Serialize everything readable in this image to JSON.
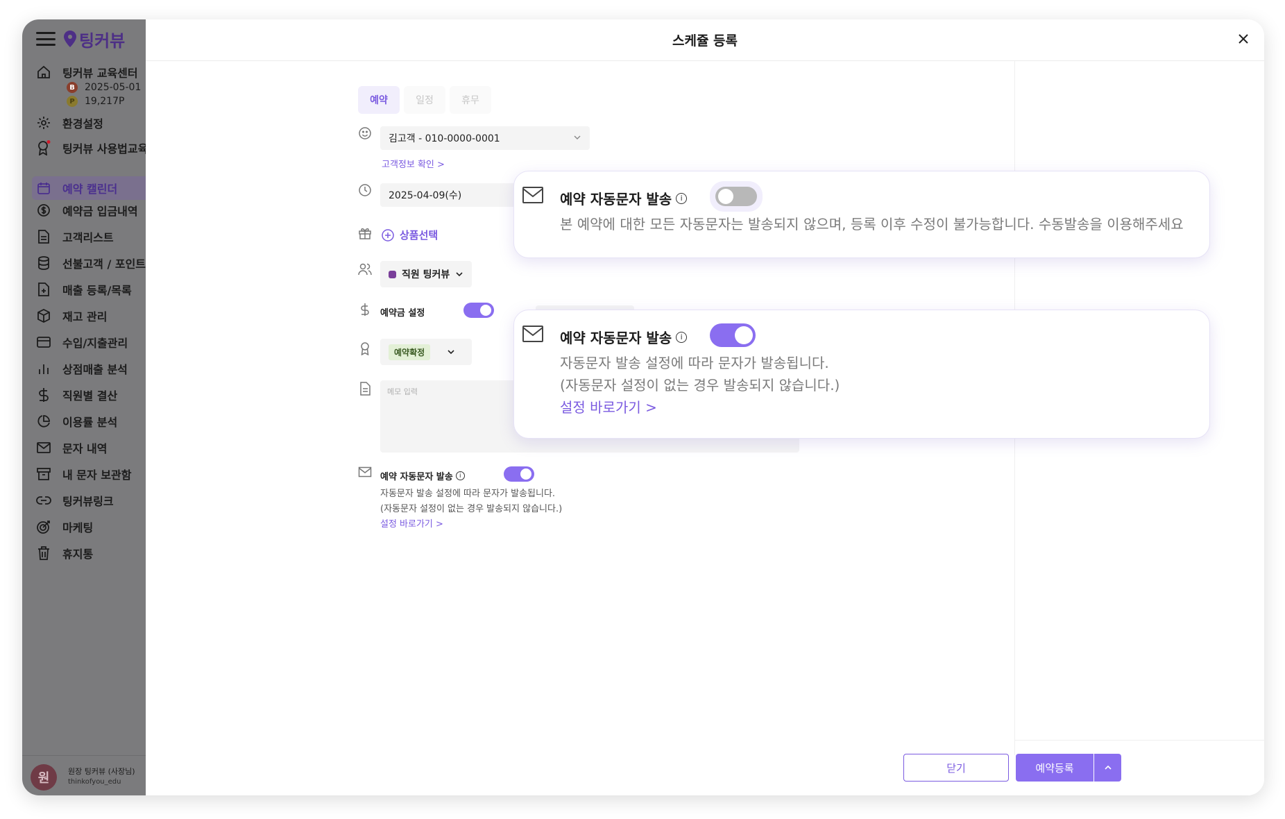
{
  "sidebar": {
    "logo": "팅커뷰",
    "org_name": "팅커뷰 교육센터",
    "expiry_date": "2025-05-01",
    "points": "19,217P",
    "items": [
      {
        "label": "환경설정",
        "icon": "gear-icon"
      },
      {
        "label": "팅커뷰 사용법교육",
        "icon": "award-icon"
      },
      {
        "label": "예약 캘린더",
        "icon": "calendar-icon"
      },
      {
        "label": "예약금 입금내역",
        "icon": "dollar-circle-icon"
      },
      {
        "label": "고객리스트",
        "icon": "file-icon"
      },
      {
        "label": "선불고객 / 포인트",
        "icon": "database-icon"
      },
      {
        "label": "매출 등록/목록",
        "icon": "file-plus-icon"
      },
      {
        "label": "재고 관리",
        "icon": "box-icon"
      },
      {
        "label": "수입/지출관리",
        "icon": "card-icon"
      },
      {
        "label": "상점매출 분석",
        "icon": "bar-chart-icon"
      },
      {
        "label": "직원별 결산",
        "icon": "dollar-icon"
      },
      {
        "label": "이용률 분석",
        "icon": "pie-icon"
      },
      {
        "label": "문자 내역",
        "icon": "mail-icon"
      },
      {
        "label": "내 문자 보관함",
        "icon": "archive-icon"
      },
      {
        "label": "팅커뷰링크",
        "icon": "link-icon"
      },
      {
        "label": "마케팅",
        "icon": "target-icon"
      },
      {
        "label": "휴지통",
        "icon": "trash-icon"
      }
    ],
    "user": {
      "avatar": "원",
      "name": "원장 팅커뷰 (사장님)",
      "id": "thinkofyou_edu"
    }
  },
  "modal": {
    "title": "스케쥴 등록",
    "tabs": [
      "예약",
      "일정",
      "휴무"
    ],
    "customer": "김고객 - 010-0000-0001",
    "customer_link": "고객정보 확인 >",
    "date": "2025-04-09(수)",
    "product_select": "상품선택",
    "staff": "직원 팅커뷰",
    "deposit_label": "예약금 설정",
    "status": "예약확정",
    "memo_placeholder": "메모 입력",
    "sms_label": "예약 자동문자 발송",
    "sms_desc_1": "자동문자 발송 설정에 따라 문자가 발송됩니다.",
    "sms_desc_2": "(자동문자 설정이 없는 경우 발송되지 않습니다.)",
    "sms_link": "설정 바로가기 >",
    "close_button": "닫기",
    "submit_button": "예약등록"
  },
  "callout_off": {
    "title": "예약 자동문자 발송",
    "text": "본 예약에 대한 모든 자동문자는 발송되지 않으며, 등록 이후 수정이 불가능합니다. 수동발송을 이용해주세요"
  },
  "callout_on": {
    "title": "예약 자동문자 발송",
    "text_1": "자동문자 발송 설정에 따라 문자가 발송됩니다.",
    "text_2": "(자동문자 설정이 없는 경우 발송되지 않습니다.)",
    "link": "설정 바로가기 >"
  },
  "colors": {
    "accent": "#8a6ef0",
    "sidebar_bg": "#7b7b7d"
  }
}
